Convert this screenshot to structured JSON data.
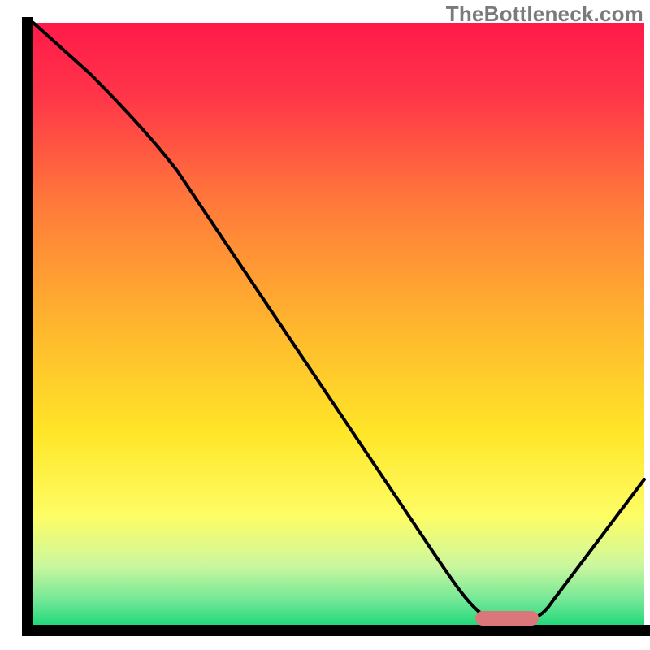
{
  "watermark": "TheBottleneck.com",
  "chart_data": {
    "type": "line",
    "title": "",
    "xlabel": "",
    "ylabel": "",
    "xlim": [
      0,
      100
    ],
    "ylim": [
      0,
      100
    ],
    "grid": false,
    "legend": false,
    "annotations": [],
    "marker": {
      "x_start": 73,
      "x_end": 83,
      "y": 1.5,
      "color": "#d9777a",
      "shape": "pill"
    },
    "background_gradient": {
      "direction": "vertical",
      "stops": [
        {
          "pos": 0.0,
          "color": "#ff1a49"
        },
        {
          "pos": 0.12,
          "color": "#ff3549"
        },
        {
          "pos": 0.3,
          "color": "#ff7a3a"
        },
        {
          "pos": 0.5,
          "color": "#ffb52e"
        },
        {
          "pos": 0.68,
          "color": "#ffe628"
        },
        {
          "pos": 0.82,
          "color": "#fdfd66"
        },
        {
          "pos": 0.9,
          "color": "#ccf79e"
        },
        {
          "pos": 0.96,
          "color": "#6fe796"
        },
        {
          "pos": 1.0,
          "color": "#1fd87a"
        }
      ]
    },
    "series": [
      {
        "name": "curve",
        "color": "#000000",
        "x": [
          1,
          10,
          24,
          40,
          55,
          70,
          75,
          80,
          83,
          90,
          100
        ],
        "y": [
          100,
          92,
          78,
          56,
          34,
          12,
          2,
          1,
          1,
          10,
          24
        ]
      }
    ],
    "note": "Only the black curve, the gradient fill, the pink pill marker near the bottom, the black L-shaped axes and the top-right watermark are visible. No axis ticks, labels, or gridlines are shown."
  }
}
